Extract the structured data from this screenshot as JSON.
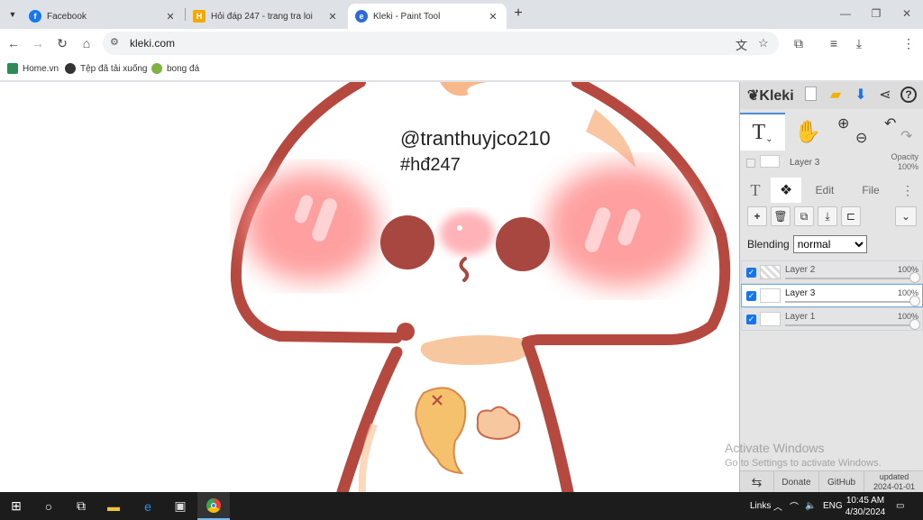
{
  "browser": {
    "tabs": [
      {
        "label": "Facebook",
        "color": "#1877f2",
        "icon": "facebook-icon",
        "active": false
      },
      {
        "label": "Hỏi đáp 247 - trang tra loi",
        "color": "#f2a900",
        "icon": "hoidap-icon",
        "active": false
      },
      {
        "label": "Kleki - Paint Tool",
        "color": "#2f6bd6",
        "icon": "kleki-icon",
        "active": true
      }
    ],
    "url": "kleki.com",
    "bookmarks": [
      {
        "label": "Home.vn",
        "color": "#2e8b57"
      },
      {
        "label": "Tệp đã tải xuống",
        "color": "#333333"
      },
      {
        "label": "bong đá",
        "color": "#7cb342"
      }
    ]
  },
  "canvas": {
    "text_line1": "@tranthuyjco210",
    "text_line2": "#hđ247",
    "colors": {
      "outline": "#b5483f",
      "blush": "#ff8f8f",
      "belly": "#f7c7a0",
      "fish": "#f5c16c"
    }
  },
  "kleki": {
    "logo": "Kleki",
    "layer_preview": {
      "name": "Layer 3",
      "opacity_label": "Opacity",
      "opacity_value": "100%"
    },
    "panel_tabs": {
      "edit": "Edit",
      "file": "File"
    },
    "blending_label": "Blending",
    "blending_value": "normal",
    "blending_options": [
      "normal"
    ],
    "layers": [
      {
        "name": "Layer 2",
        "opacity": "100%",
        "selected": false
      },
      {
        "name": "Layer 3",
        "opacity": "100%",
        "selected": true
      },
      {
        "name": "Layer 1",
        "opacity": "100%",
        "selected": false
      }
    ],
    "bottom": {
      "donate": "Donate",
      "github": "GitHub",
      "updated_label": "updated",
      "updated_date": "2024-01-01"
    }
  },
  "watermark": {
    "line1": "Activate Windows",
    "line2": "Go to Settings to activate Windows."
  },
  "taskbar": {
    "links": "Links",
    "lang": "ENG",
    "time": "10:45 AM",
    "date": "4/30/2024"
  }
}
